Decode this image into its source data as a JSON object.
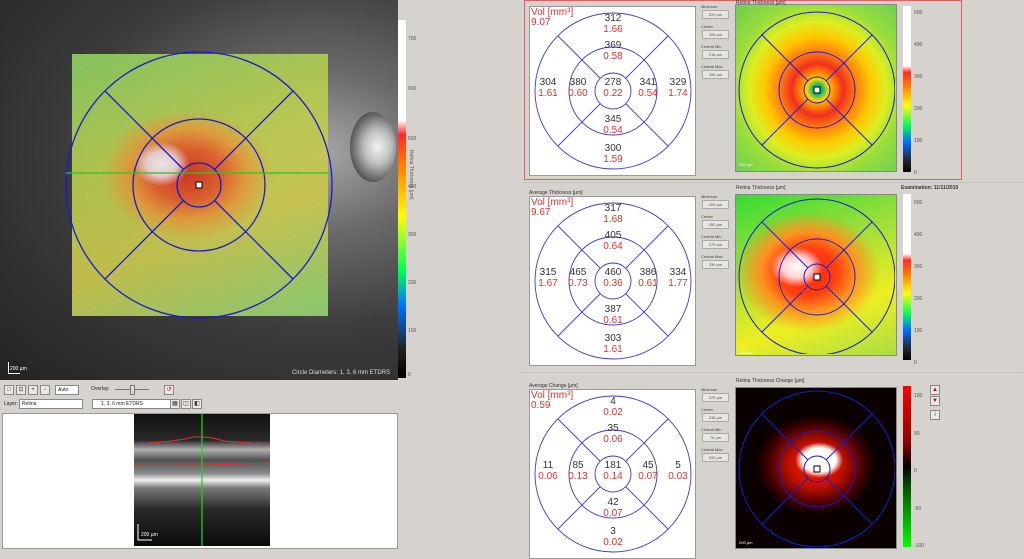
{
  "left": {
    "fundus_scale_bar": "200 µm",
    "circle_caption": "Circle Diameters: 1, 3, 6 mm ETDRS",
    "legend_ticks": [
      "700",
      "600",
      "500",
      "400",
      "300",
      "200",
      "100",
      "0"
    ],
    "legend_label": "Retina Thickness [µm]",
    "toolbar": {
      "zoom_select": "Auto",
      "overlay_label": "Overlay:",
      "layer_label": "Layer:",
      "layer_value": "Retina",
      "grid_value": "1, 3, 6 mm ETDRS"
    },
    "oct": {
      "scale_bar": "200 µm"
    }
  },
  "panels": [
    {
      "id": "top",
      "title": "",
      "vol_label": "Vol [mm³]",
      "vol": "9.07",
      "sectors": {
        "outer_sup": {
          "t": "312",
          "v": "1.66"
        },
        "inner_sup": {
          "t": "369",
          "v": "0.58"
        },
        "outer_temp": {
          "t": "304",
          "v": "1.61"
        },
        "inner_temp": {
          "t": "380",
          "v": "0.60"
        },
        "center": {
          "t": "278",
          "v": "0.22"
        },
        "inner_nasal": {
          "t": "341",
          "v": "0.54"
        },
        "outer_nasal": {
          "t": "329",
          "v": "1.74"
        },
        "inner_inf": {
          "t": "345",
          "v": "0.54"
        },
        "outer_inf": {
          "t": "300",
          "v": "1.59"
        }
      },
      "stats": [
        {
          "label": "Minimum",
          "value": "229 µm"
        },
        {
          "label": "Center",
          "value": "326 µm"
        },
        {
          "label": "Central Min",
          "value": "218 µm"
        },
        {
          "label": "Central Max",
          "value": "396 µm"
        }
      ],
      "thumb_title": "Retina Thickness [µm]",
      "thumb_scale": "200 µm",
      "exam_date": "",
      "legend_ticks": [
        "500",
        "400",
        "300",
        "200",
        "100",
        "0"
      ]
    },
    {
      "id": "middle",
      "title": "Average Thickness [µm]",
      "vol_label": "Vol [mm³]",
      "vol": "9.67",
      "sectors": {
        "outer_sup": {
          "t": "317",
          "v": "1.68"
        },
        "inner_sup": {
          "t": "405",
          "v": "0.64"
        },
        "outer_temp": {
          "t": "315",
          "v": "1.67"
        },
        "inner_temp": {
          "t": "465",
          "v": "0.73"
        },
        "center": {
          "t": "460",
          "v": "0.36"
        },
        "inner_nasal": {
          "t": "386",
          "v": "0.61"
        },
        "outer_nasal": {
          "t": "334",
          "v": "1.77"
        },
        "inner_inf": {
          "t": "387",
          "v": "0.61"
        },
        "outer_inf": {
          "t": "303",
          "v": "1.61"
        }
      },
      "stats": [
        {
          "label": "Minimum",
          "value": "405 µm"
        },
        {
          "label": "Center",
          "value": "450 µm"
        },
        {
          "label": "Central Min",
          "value": "279 µm"
        },
        {
          "label": "Central Max",
          "value": "339 µm"
        }
      ],
      "thumb_title": "Retina Thickness [µm]",
      "thumb_scale": "200 µm",
      "exam_date": "Examination: 11/11/2010",
      "legend_ticks": [
        "500",
        "400",
        "300",
        "200",
        "100",
        "0"
      ]
    },
    {
      "id": "bottom",
      "title": "Average Change [µm]",
      "vol_label": "Vol [mm³]",
      "vol": "0.59",
      "sectors": {
        "outer_sup": {
          "t": "4",
          "v": "0.02"
        },
        "inner_sup": {
          "t": "35",
          "v": "0.06"
        },
        "outer_temp": {
          "t": "11",
          "v": "0.06"
        },
        "inner_temp": {
          "t": "85",
          "v": "0.13"
        },
        "center": {
          "t": "181",
          "v": "0.14"
        },
        "inner_nasal": {
          "t": "45",
          "v": "0.07"
        },
        "outer_nasal": {
          "t": "5",
          "v": "0.03"
        },
        "inner_inf": {
          "t": "42",
          "v": "0.07"
        },
        "outer_inf": {
          "t": "3",
          "v": "0.02"
        }
      },
      "stats": [
        {
          "label": "Minimum",
          "value": "229 µm"
        },
        {
          "label": "Center",
          "value": "236 µm"
        },
        {
          "label": "Central Min",
          "value": "76 µm"
        },
        {
          "label": "Central Max",
          "value": "293 µm"
        }
      ],
      "thumb_title": "Retina Thickness Change [µm]",
      "thumb_scale": "200 µm",
      "exam_date": "",
      "legend_ticks": [
        "100",
        "50",
        "0",
        "-50",
        "-100"
      ]
    }
  ]
}
